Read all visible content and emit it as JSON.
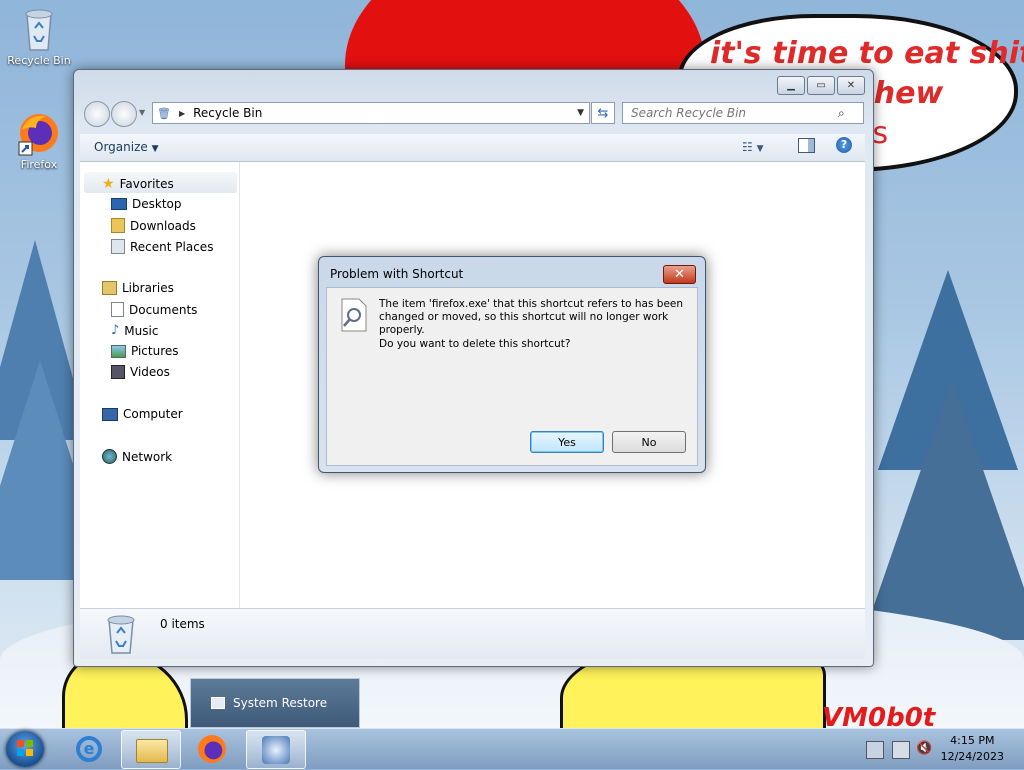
{
  "desktop": {
    "icons": [
      {
        "label": "Recycle Bin"
      },
      {
        "label": "Firefox"
      }
    ],
    "speech_lines": [
      "it's time to eat shit",
      "chew",
      "es"
    ],
    "signature": "VM0b0t"
  },
  "explorer": {
    "address": "Recycle Bin",
    "search_placeholder": "Search Recycle Bin",
    "organize_label": "Organize",
    "nav": {
      "favorites": "Favorites",
      "favorites_items": [
        "Desktop",
        "Downloads",
        "Recent Places"
      ],
      "libraries": "Libraries",
      "libraries_items": [
        "Documents",
        "Music",
        "Pictures",
        "Videos"
      ],
      "computer": "Computer",
      "network": "Network"
    },
    "status": "0 items"
  },
  "dialog": {
    "title": "Problem with Shortcut",
    "message": "The item 'firefox.exe' that this shortcut refers to has been changed or moved, so this shortcut will no longer work properly.",
    "question": "Do you want to delete this shortcut?",
    "yes_label": "Yes",
    "no_label": "No"
  },
  "popup": {
    "label": "System Restore"
  },
  "taskbar": {
    "time": "4:15 PM",
    "date": "12/24/2023"
  },
  "colors": {
    "speech_text": "#e02a2a",
    "hat": "#e31010",
    "taskbar": "#8fabc9"
  }
}
